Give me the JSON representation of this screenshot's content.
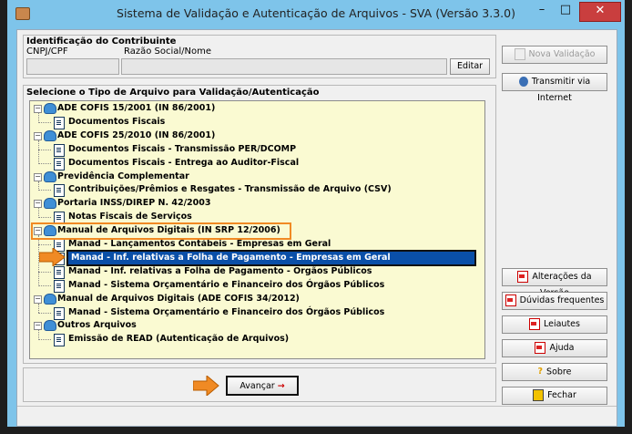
{
  "window": {
    "title": "Sistema de Validação e Autenticação de Arquivos - SVA (Versão 3.3.0)",
    "controls": {
      "minimize": "–",
      "maximize": "□",
      "close": "✕"
    }
  },
  "contribuinte": {
    "group_title": "Identificação do Contribuinte",
    "cnpj_label": "CNPJ/CPF",
    "razao_label": "Razão Social/Nome",
    "cnpj_value": "",
    "razao_value": "",
    "edit_button": "Editar"
  },
  "selection": {
    "group_title": "Selecione o Tipo de Arquivo para Validação/Autenticação",
    "tree": [
      {
        "label": "ADE COFIS 15/2001 (IN 86/2001)",
        "level": 0,
        "type": "folder"
      },
      {
        "label": "Documentos Fiscais",
        "level": 1,
        "type": "doc"
      },
      {
        "label": "ADE COFIS 25/2010 (IN 86/2001)",
        "level": 0,
        "type": "folder"
      },
      {
        "label": "Documentos Fiscais - Transmissão PER/DCOMP",
        "level": 1,
        "type": "doc"
      },
      {
        "label": "Documentos Fiscais - Entrega ao Auditor-Fiscal",
        "level": 1,
        "type": "doc"
      },
      {
        "label": "Previdência Complementar",
        "level": 0,
        "type": "folder"
      },
      {
        "label": "Contribuições/Prêmios e Resgates - Transmissão de Arquivo (CSV)",
        "level": 1,
        "type": "doc"
      },
      {
        "label": "Portaria INSS/DIREP N. 42/2003",
        "level": 0,
        "type": "folder"
      },
      {
        "label": "Notas Fiscais de Serviços",
        "level": 1,
        "type": "doc"
      },
      {
        "label": "Manual de Arquivos Digitais (IN SRP 12/2006)",
        "level": 0,
        "type": "folder"
      },
      {
        "label": "Manad - Lançamentos Contábeis - Empresas em Geral",
        "level": 1,
        "type": "doc"
      },
      {
        "label": "Manad - Inf. relativas a Folha de Pagamento - Empresas em Geral",
        "level": 1,
        "type": "doc",
        "selected": true
      },
      {
        "label": "Manad - Inf. relativas a Folha de Pagamento - Órgãos Públicos",
        "level": 1,
        "type": "doc"
      },
      {
        "label": "Manad - Sistema Orçamentário e Financeiro dos Órgãos Públicos",
        "level": 1,
        "type": "doc"
      },
      {
        "label": "Manual de Arquivos Digitais (ADE COFIS 34/2012)",
        "level": 0,
        "type": "folder"
      },
      {
        "label": "Manad - Sistema Orçamentário e Financeiro dos Órgãos Públicos",
        "level": 1,
        "type": "doc"
      },
      {
        "label": "Outros Arquivos",
        "level": 0,
        "type": "folder"
      },
      {
        "label": "Emissão de READ (Autenticação de Arquivos)",
        "level": 1,
        "type": "doc"
      }
    ]
  },
  "actions": {
    "avancar": "Avançar"
  },
  "side_buttons": {
    "nova_validacao": "Nova Validação",
    "transmitir": "Transmitir via Internet",
    "alteracoes": "Alterações da Versão",
    "duvidas": "Dúvidas frequentes",
    "leiautes": "Leiautes",
    "ajuda": "Ajuda",
    "sobre": "Sobre",
    "fechar": "Fechar"
  },
  "colors": {
    "selection": "#0a4fa8",
    "highlight": "#f08a24",
    "tree_bg": "#fafad2"
  }
}
